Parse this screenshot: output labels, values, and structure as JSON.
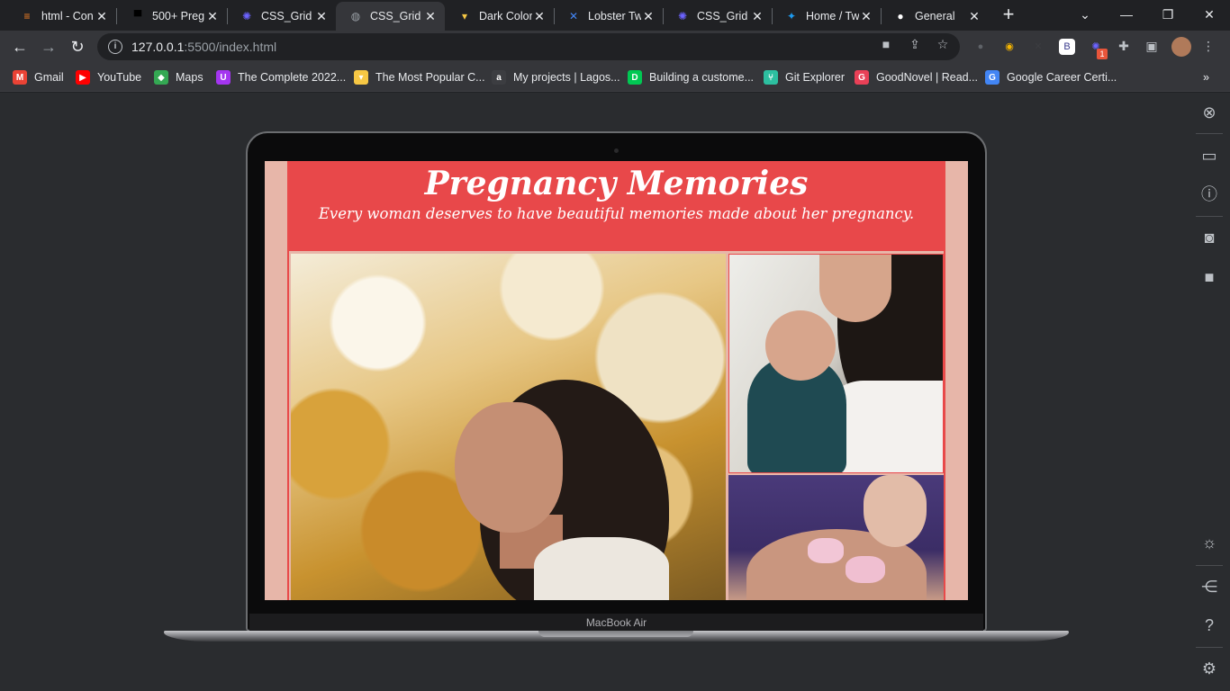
{
  "tabs": [
    {
      "title": "html - Con",
      "favicon": "stackoverflow-icon",
      "color": "#f48024",
      "glyph": "≡"
    },
    {
      "title": "500+ Preg",
      "favicon": "unsplash-icon",
      "color": "#000000",
      "glyph": "▀"
    },
    {
      "title": "CSS_Grid -",
      "favicon": "codepen-star-icon",
      "color": "#6c63ff",
      "glyph": "✺"
    },
    {
      "title": "CSS_Grid",
      "favicon": "globe-icon",
      "color": "#9aa0a6",
      "glyph": "◍",
      "active": true
    },
    {
      "title": "Dark Color",
      "favicon": "colorhunt-icon",
      "color": "#f6c744",
      "glyph": "▾"
    },
    {
      "title": "Lobster Tw",
      "favicon": "google-fonts-icon",
      "color": "#4285f4",
      "glyph": "✕"
    },
    {
      "title": "CSS_Grid -",
      "favicon": "codepen-star-icon",
      "color": "#6c63ff",
      "glyph": "✺"
    },
    {
      "title": "Home / Tw",
      "favicon": "twitter-icon",
      "color": "#1d9bf0",
      "glyph": "✦"
    },
    {
      "title": "General",
      "favicon": "github-icon",
      "color": "#ffffff",
      "glyph": "●"
    }
  ],
  "toolbar": {
    "url_host": "127.0.0.1",
    "url_path": ":5500/index.html"
  },
  "bookmarks": [
    {
      "label": "Gmail",
      "icon": "gmail-icon",
      "color": "#ea4335",
      "glyph": "M"
    },
    {
      "label": "YouTube",
      "icon": "youtube-icon",
      "color": "#ff0000",
      "glyph": "▶"
    },
    {
      "label": "Maps",
      "icon": "maps-icon",
      "color": "#34a853",
      "glyph": "◆"
    },
    {
      "label": "The Complete 2022...",
      "icon": "udemy-icon",
      "color": "#a435f0",
      "glyph": "U"
    },
    {
      "label": "The Most Popular C...",
      "icon": "colorhunt-icon",
      "color": "#f6c744",
      "glyph": "▾"
    },
    {
      "label": "My projects | Lagos...",
      "icon": "altschool-icon",
      "color": "#3c3d41",
      "glyph": "a"
    },
    {
      "label": "Building a custome...",
      "icon": "dev-icon",
      "color": "#00c853",
      "glyph": "D"
    },
    {
      "label": "Git Explorer",
      "icon": "git-explorer-icon",
      "color": "#2dbfa0",
      "glyph": "⑂"
    },
    {
      "label": "GoodNovel | Read...",
      "icon": "goodnovel-icon",
      "color": "#e94057",
      "glyph": "G"
    },
    {
      "label": "Google Career Certi...",
      "icon": "google-icon",
      "color": "#4285f4",
      "glyph": "G"
    }
  ],
  "extensions": [
    {
      "name": "mic-ext-icon",
      "color": "#5f6368",
      "glyph": "●"
    },
    {
      "name": "colorzilla-ext-icon",
      "color": "#f4b400",
      "glyph": "◉"
    },
    {
      "name": "excel-ext-icon",
      "color": "#3c3d41",
      "glyph": "✕"
    },
    {
      "name": "bitly-ext-icon",
      "color": "#ffffff",
      "glyph": "B"
    },
    {
      "name": "codepen-ext-icon",
      "color": "#6c63ff",
      "glyph": "✺",
      "badge": "1"
    }
  ],
  "device": {
    "label": "MacBook Air"
  },
  "site": {
    "title": "Pregnancy Memories",
    "subtitle": "Every woman deserves to have beautiful memories made about her pregnancy."
  }
}
